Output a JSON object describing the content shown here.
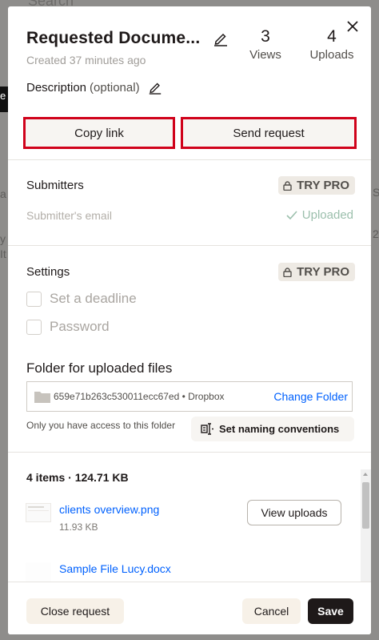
{
  "background": {
    "search_label": "Search",
    "fragments": [
      "e",
      "a",
      "S",
      "y",
      "It",
      "2"
    ]
  },
  "header": {
    "title": "Requested Docume...",
    "created": "Created 37 minutes ago",
    "views_count": "3",
    "views_label": "Views",
    "uploads_count": "4",
    "uploads_label": "Uploads"
  },
  "description": {
    "label": "Description",
    "optional": "(optional)"
  },
  "actions": {
    "copy_link": "Copy link",
    "send_request": "Send request"
  },
  "submitters": {
    "heading": "Submitters",
    "pro_badge": "TRY PRO",
    "email_placeholder": "Submitter's email",
    "uploaded_label": "Uploaded"
  },
  "settings": {
    "heading": "Settings",
    "pro_badge": "TRY PRO",
    "deadline_label": "Set a deadline",
    "password_label": "Password"
  },
  "folder": {
    "heading": "Folder for uploaded files",
    "path": "659e71b263c530011ecc67ed • Dropbox",
    "change_label": "Change Folder",
    "access_note": "Only you have access to this folder",
    "naming_label": "Set naming conventions"
  },
  "files": {
    "summary": "4 items · 124.71 KB",
    "items": [
      {
        "name": "clients overview.png",
        "size": "11.93 KB"
      },
      {
        "name": "Sample File Lucy.docx",
        "size": ""
      }
    ],
    "view_uploads_label": "View uploads"
  },
  "footer": {
    "close_request": "Close request",
    "cancel": "Cancel",
    "save": "Save"
  },
  "colors": {
    "accent_link": "#0061fe",
    "highlight_border": "#d0021b",
    "primary_button": "#1e1919",
    "uploaded_green": "#9bbfac"
  }
}
